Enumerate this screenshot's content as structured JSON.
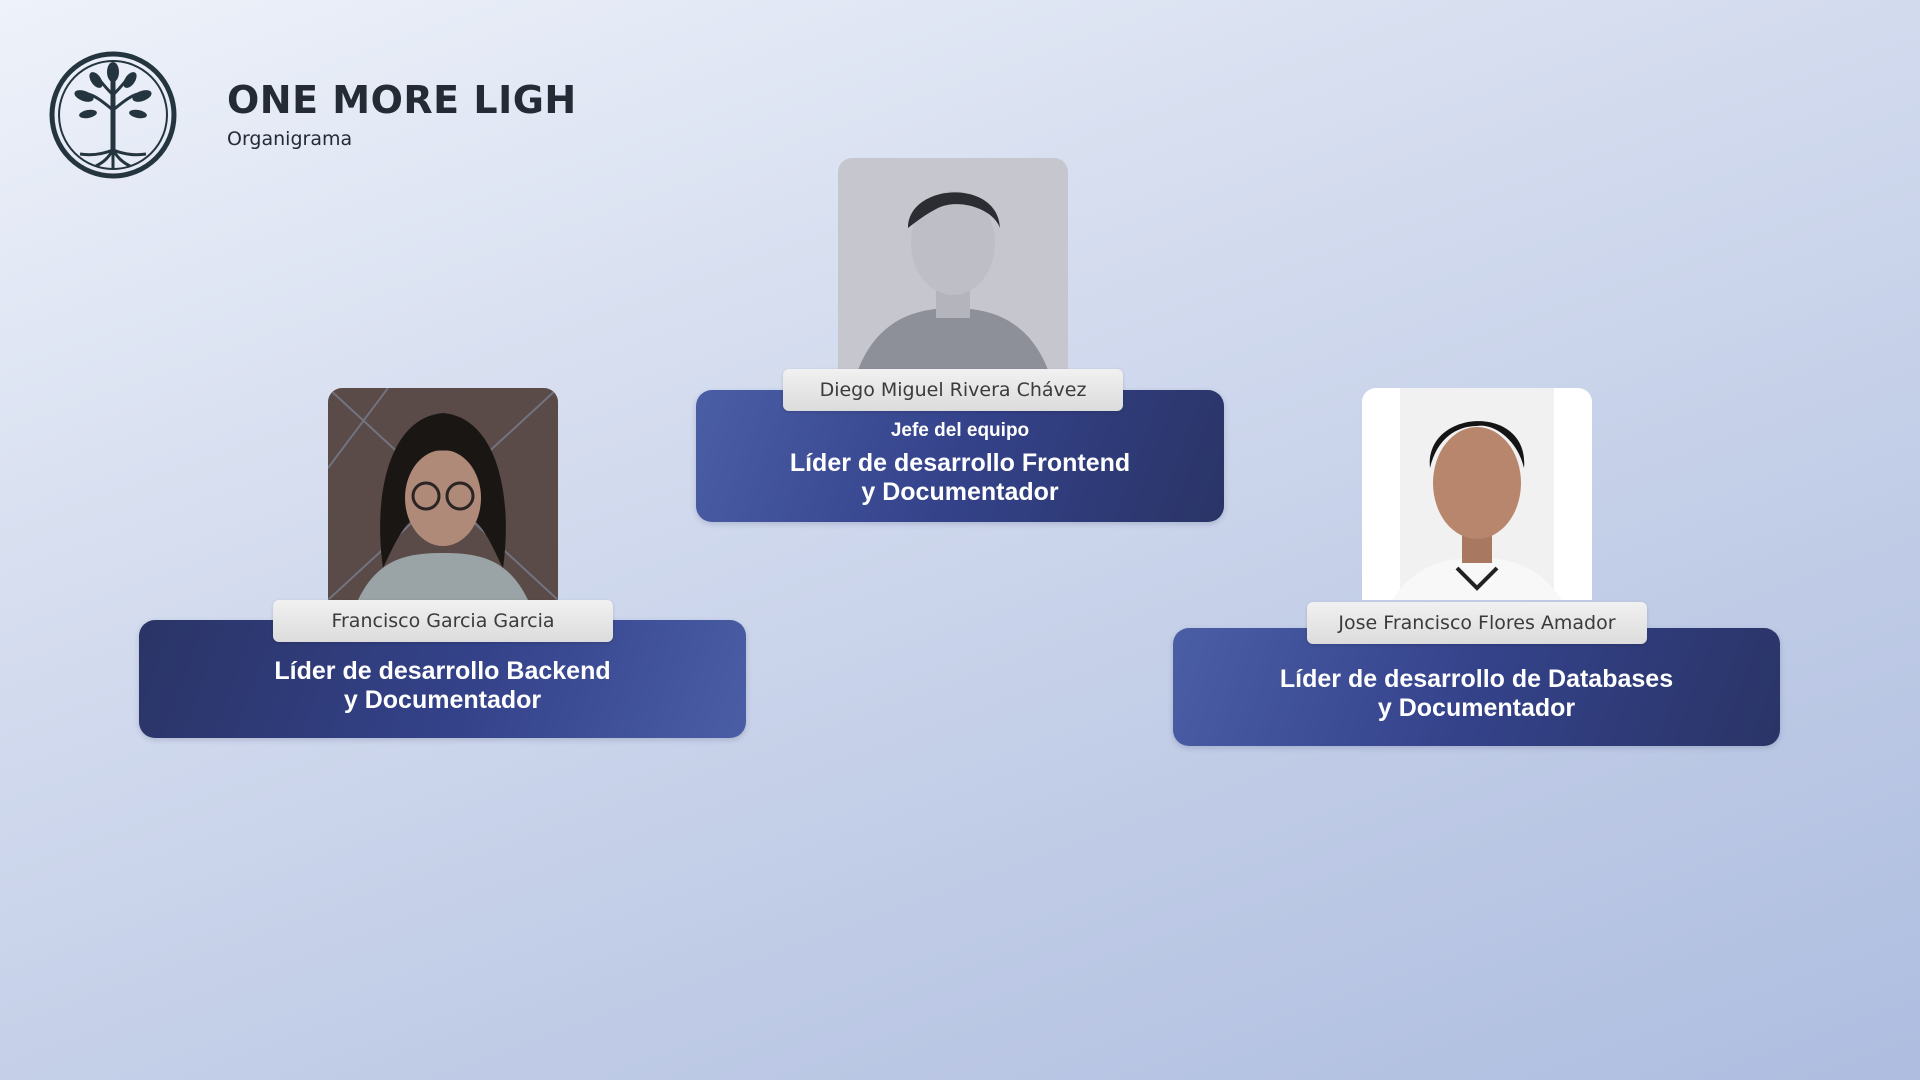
{
  "header": {
    "title": "ONE MORE LIGH",
    "subtitle": "Organigrama"
  },
  "icons": {
    "logo": "tree-of-life-logo",
    "photos": "person-photo"
  },
  "colors": {
    "card_dark": "#2a3466",
    "card_light": "#4a5ea6",
    "title_text": "#252b34",
    "pill_bg": "#e6e6e6"
  },
  "members": {
    "leader": {
      "name": "Diego Miguel Rivera Chávez",
      "tag": "Jefe del equipo",
      "role_line1": "Líder de desarrollo Frontend",
      "role_line2": "y Documentador"
    },
    "backend": {
      "name": "Francisco Garcia Garcia",
      "role_line1": "Líder de desarrollo Backend",
      "role_line2": "y Documentador"
    },
    "databases": {
      "name": "Jose Francisco Flores Amador",
      "role_line1": "Líder de desarrollo de Databases",
      "role_line2": "y Documentador"
    }
  }
}
